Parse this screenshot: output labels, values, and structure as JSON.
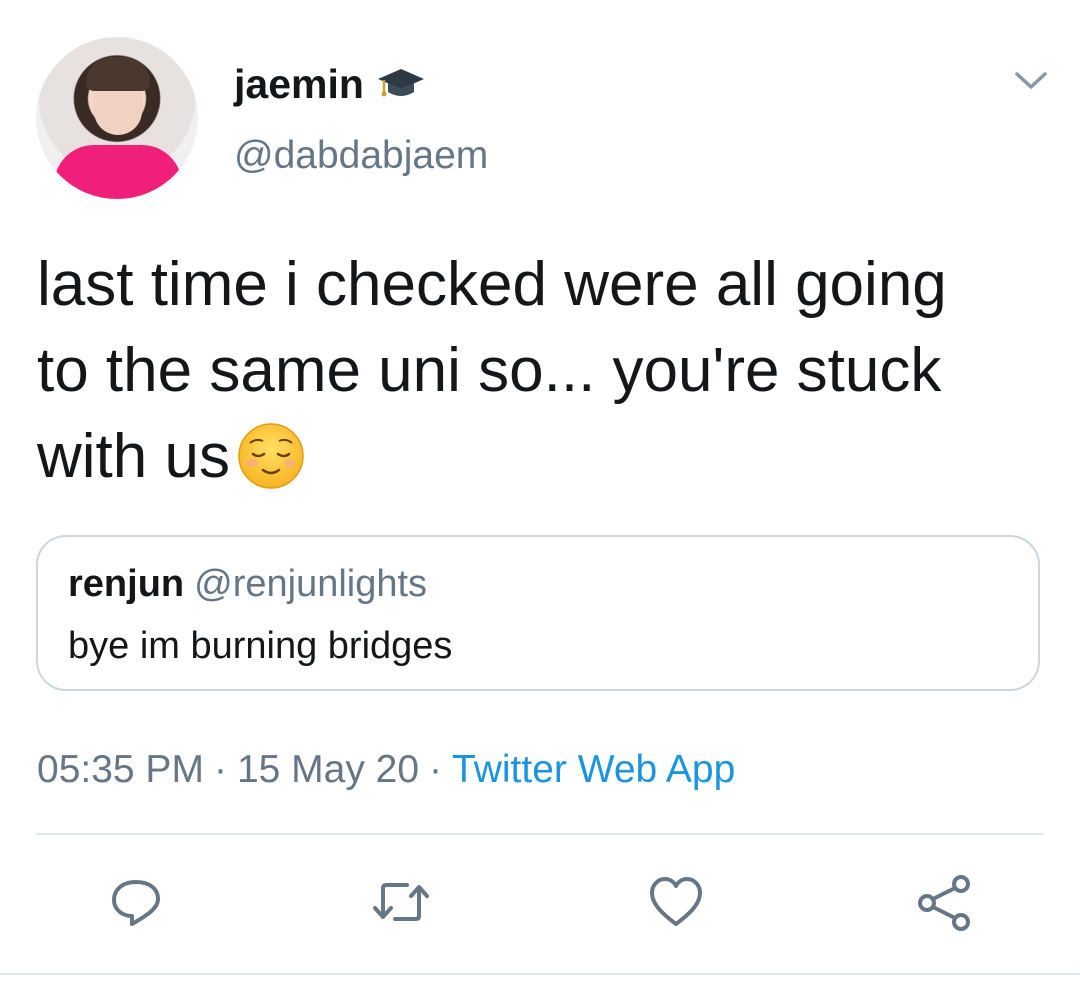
{
  "tweet": {
    "author": {
      "display_name": "jaemin",
      "handle": "@dabdabjaem",
      "badge_icon": "graduation-cap-emoji"
    },
    "text": "last time i checked were all going\nto the same uni so... you're stuck\nwith us",
    "text_emoji": "relieved-face-emoji",
    "quoted": {
      "display_name": "renjun",
      "handle": "@renjunlights",
      "text": "bye im burning bridges"
    },
    "meta": {
      "time": "05:35 PM",
      "separator": "·",
      "date": "15 May 20",
      "source": "Twitter Web App"
    },
    "actions": [
      "reply-icon",
      "retweet-icon",
      "like-icon",
      "share-icon"
    ]
  },
  "colors": {
    "text_primary": "#14171a",
    "text_secondary": "#657786",
    "link": "#1b95e0",
    "border": "#ccd6dd",
    "divider": "#e1e8ed"
  }
}
